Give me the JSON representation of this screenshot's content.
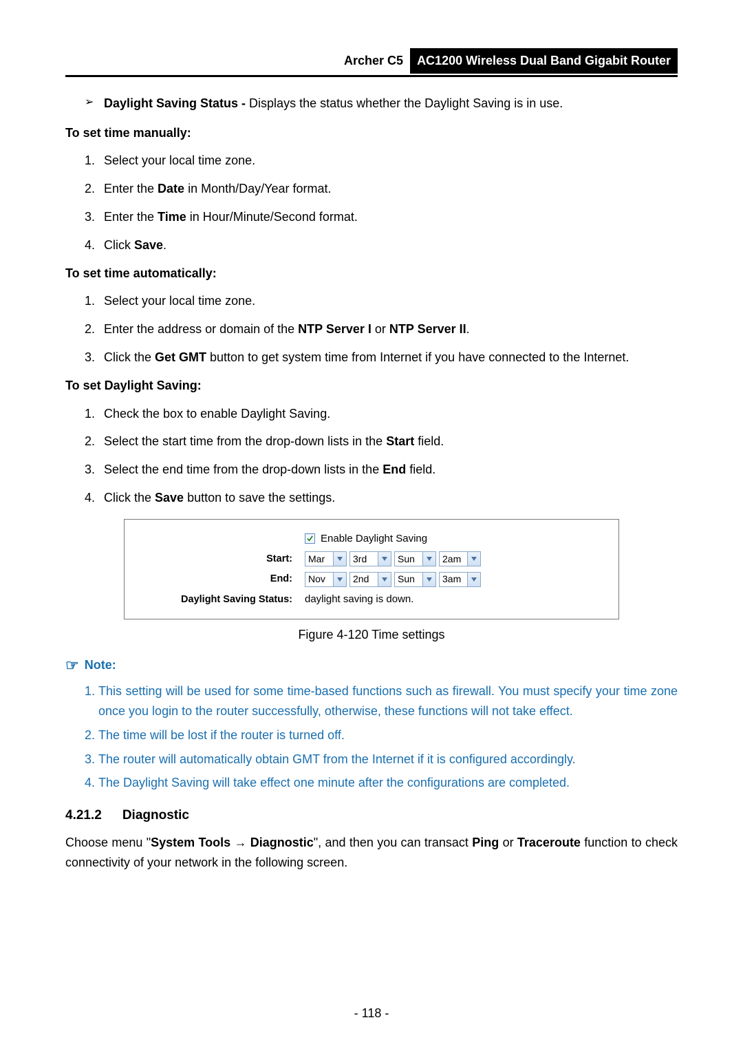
{
  "header": {
    "model": "Archer C5",
    "product": "AC1200 Wireless Dual Band Gigabit Router"
  },
  "bullet1_label": "Daylight Saving Status -",
  "bullet1_text": " Displays the status whether the Daylight Saving is in use.",
  "manual_head": "To set time manually:",
  "manual": {
    "i1a": "Select your local time zone.",
    "i2a": "Enter the ",
    "i2b": "Date",
    "i2c": " in Month/Day/Year format.",
    "i3a": "Enter the ",
    "i3b": "Time",
    "i3c": " in Hour/Minute/Second format.",
    "i4a": "Click ",
    "i4b": "Save",
    "i4c": "."
  },
  "auto_head": "To set time automatically:",
  "auto": {
    "i1": "Select your local time zone.",
    "i2a": "Enter the address or domain of the ",
    "i2b": "NTP Server I",
    "i2c": " or ",
    "i2d": "NTP Server II",
    "i2e": ".",
    "i3a": "Click the ",
    "i3b": "Get GMT",
    "i3c": " button to get system time from Internet if you have connected to the Internet."
  },
  "ds_head": "To set Daylight Saving:",
  "ds": {
    "i1": "Check the box to enable Daylight Saving.",
    "i2a": "Select the start time from the drop-down lists in the ",
    "i2b": "Start",
    "i2c": " field.",
    "i3a": "Select the end time from the drop-down lists in the ",
    "i3b": "End",
    "i3c": " field.",
    "i4a": "Click the ",
    "i4b": "Save",
    "i4c": " button to save the settings."
  },
  "figure": {
    "enable_label": "Enable Daylight Saving",
    "start_label": "Start:",
    "end_label": "End:",
    "status_label": "Daylight Saving Status:",
    "status_value": "daylight saving is down.",
    "start": {
      "mon": "Mar",
      "wk": "3rd",
      "day": "Sun",
      "hr": "2am"
    },
    "end": {
      "mon": "Nov",
      "wk": "2nd",
      "day": "Sun",
      "hr": "3am"
    }
  },
  "caption": "Figure 4-120 Time settings",
  "note_label": "Note:",
  "notes": {
    "n1": "This setting will be used for some time-based functions such as firewall. You must specify your time zone once you login to the router successfully, otherwise, these functions will not take effect.",
    "n2": "The time will be lost if the router is turned off.",
    "n3": "The router will automatically obtain GMT from the Internet if it is configured accordingly.",
    "n4": "The Daylight Saving will take effect one minute after the configurations are completed."
  },
  "section": {
    "num": "4.21.2",
    "title": "Diagnostic"
  },
  "diag": {
    "a": "Choose menu \"",
    "b": "System Tools",
    "c": "Diagnostic",
    "d": "\", and then you can transact ",
    "e": "Ping",
    "f": " or ",
    "g": "Traceroute",
    "h": " function to check connectivity of your network in the following screen."
  },
  "pagenum": "- 118 -"
}
